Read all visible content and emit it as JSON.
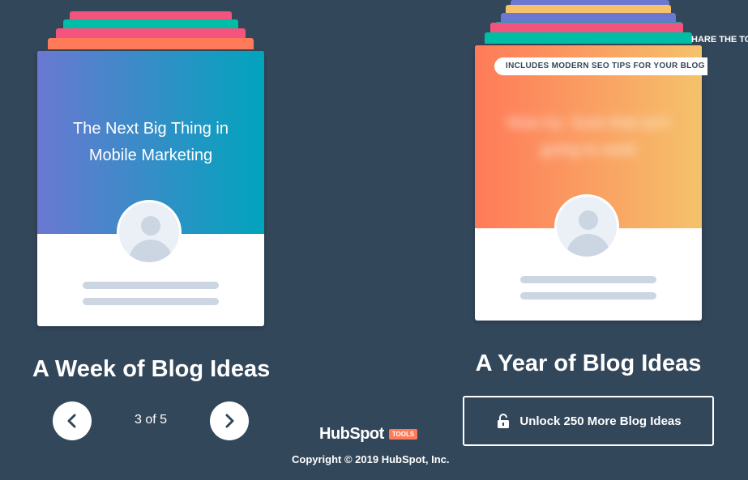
{
  "left_card": {
    "title": "The Next Big Thing in Mobile Marketing",
    "heading": "A Week of Blog Ideas"
  },
  "pager": {
    "current": 3,
    "total": 5,
    "label": "3 of 5",
    "prev_icon": "chevron-left-icon",
    "next_icon": "chevron-right-icon"
  },
  "right_card": {
    "badge": "INCLUDES MODERN SEO TIPS FOR YOUR BLOG",
    "blurred_title": "Now try: Sure that isn't going to work",
    "heading": "A Year of Blog Ideas",
    "share_partial": "HARE THE TO"
  },
  "unlock": {
    "label": "Unlock 250 More Blog Ideas",
    "icon": "unlock-icon"
  },
  "footer": {
    "brand": "HubSpot",
    "brand_tag": "TOOLS",
    "copyright": "Copyright © 2019 HubSpot, Inc."
  },
  "colors": {
    "background": "#33475b",
    "accent_orange": "#ff7a59",
    "accent_teal": "#00a4bd",
    "accent_purple": "#6a78d1"
  }
}
